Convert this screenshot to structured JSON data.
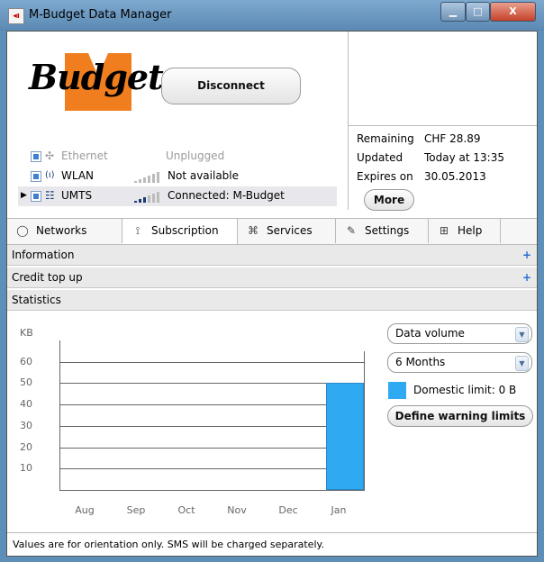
{
  "window": {
    "title": "M-Budget Data Manager",
    "controls": {
      "minimize": "▁",
      "maximize": "□",
      "close": "X"
    }
  },
  "logo": {
    "text": "Budget",
    "letter": "M"
  },
  "connection": {
    "disconnect_label": "Disconnect",
    "rows": [
      {
        "name": "Ethernet",
        "status": "Unplugged",
        "icon": "ethernet-icon",
        "enabled": false,
        "selected": false,
        "signal": 0
      },
      {
        "name": "WLAN",
        "status": "Not available",
        "icon": "wlan-icon",
        "enabled": true,
        "selected": false,
        "signal": 0
      },
      {
        "name": "UMTS",
        "status": "Connected: M-Budget",
        "icon": "umts-icon",
        "enabled": true,
        "selected": true,
        "signal": 3
      }
    ]
  },
  "account": {
    "remaining_label": "Remaining",
    "remaining_value": "CHF 28.89",
    "updated_label": "Updated",
    "updated_value": "Today at 13:35",
    "expires_label": "Expires on",
    "expires_value": "30.05.2013",
    "more_label": "More"
  },
  "tabs": [
    {
      "label": "Networks",
      "icon": "globe-icon",
      "active": false
    },
    {
      "label": "Subscription",
      "icon": "satellite-icon",
      "active": true
    },
    {
      "label": "Services",
      "icon": "gift-icon",
      "active": false
    },
    {
      "label": "Settings",
      "icon": "wrench-icon",
      "active": false
    },
    {
      "label": "Help",
      "icon": "help-icon",
      "active": false
    }
  ],
  "sections": {
    "information": "Information",
    "credit_top_up": "Credit top up",
    "statistics": "Statistics",
    "expand_symbol": "+"
  },
  "statistics": {
    "volume_select": "Data volume",
    "period_select": "6 Months",
    "domestic_limit": "Domestic limit: 0 B",
    "define_limits_label": "Define warning limits",
    "swatch_color": "#2fa9f1"
  },
  "chart_data": {
    "type": "bar",
    "ylabel": "KB",
    "categories": [
      "Aug",
      "Sep",
      "Oct",
      "Nov",
      "Dec",
      "Jan"
    ],
    "values": [
      0,
      0,
      0,
      0,
      0,
      50
    ],
    "yticks": [
      10,
      20,
      30,
      40,
      50,
      60
    ],
    "ylim": [
      0,
      70
    ],
    "grid": true,
    "bar_color": "#2fa9f1"
  },
  "footer": {
    "text": "Values are for orientation only. SMS will be charged separately."
  }
}
